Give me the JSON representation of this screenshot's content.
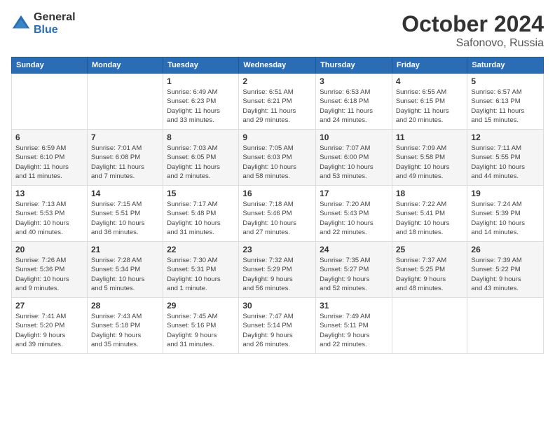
{
  "logo": {
    "general": "General",
    "blue": "Blue"
  },
  "title": "October 2024",
  "location": "Safonovo, Russia",
  "days_header": [
    "Sunday",
    "Monday",
    "Tuesday",
    "Wednesday",
    "Thursday",
    "Friday",
    "Saturday"
  ],
  "weeks": [
    [
      {
        "num": "",
        "info": ""
      },
      {
        "num": "",
        "info": ""
      },
      {
        "num": "1",
        "info": "Sunrise: 6:49 AM\nSunset: 6:23 PM\nDaylight: 11 hours\nand 33 minutes."
      },
      {
        "num": "2",
        "info": "Sunrise: 6:51 AM\nSunset: 6:21 PM\nDaylight: 11 hours\nand 29 minutes."
      },
      {
        "num": "3",
        "info": "Sunrise: 6:53 AM\nSunset: 6:18 PM\nDaylight: 11 hours\nand 24 minutes."
      },
      {
        "num": "4",
        "info": "Sunrise: 6:55 AM\nSunset: 6:15 PM\nDaylight: 11 hours\nand 20 minutes."
      },
      {
        "num": "5",
        "info": "Sunrise: 6:57 AM\nSunset: 6:13 PM\nDaylight: 11 hours\nand 15 minutes."
      }
    ],
    [
      {
        "num": "6",
        "info": "Sunrise: 6:59 AM\nSunset: 6:10 PM\nDaylight: 11 hours\nand 11 minutes."
      },
      {
        "num": "7",
        "info": "Sunrise: 7:01 AM\nSunset: 6:08 PM\nDaylight: 11 hours\nand 7 minutes."
      },
      {
        "num": "8",
        "info": "Sunrise: 7:03 AM\nSunset: 6:05 PM\nDaylight: 11 hours\nand 2 minutes."
      },
      {
        "num": "9",
        "info": "Sunrise: 7:05 AM\nSunset: 6:03 PM\nDaylight: 10 hours\nand 58 minutes."
      },
      {
        "num": "10",
        "info": "Sunrise: 7:07 AM\nSunset: 6:00 PM\nDaylight: 10 hours\nand 53 minutes."
      },
      {
        "num": "11",
        "info": "Sunrise: 7:09 AM\nSunset: 5:58 PM\nDaylight: 10 hours\nand 49 minutes."
      },
      {
        "num": "12",
        "info": "Sunrise: 7:11 AM\nSunset: 5:55 PM\nDaylight: 10 hours\nand 44 minutes."
      }
    ],
    [
      {
        "num": "13",
        "info": "Sunrise: 7:13 AM\nSunset: 5:53 PM\nDaylight: 10 hours\nand 40 minutes."
      },
      {
        "num": "14",
        "info": "Sunrise: 7:15 AM\nSunset: 5:51 PM\nDaylight: 10 hours\nand 36 minutes."
      },
      {
        "num": "15",
        "info": "Sunrise: 7:17 AM\nSunset: 5:48 PM\nDaylight: 10 hours\nand 31 minutes."
      },
      {
        "num": "16",
        "info": "Sunrise: 7:18 AM\nSunset: 5:46 PM\nDaylight: 10 hours\nand 27 minutes."
      },
      {
        "num": "17",
        "info": "Sunrise: 7:20 AM\nSunset: 5:43 PM\nDaylight: 10 hours\nand 22 minutes."
      },
      {
        "num": "18",
        "info": "Sunrise: 7:22 AM\nSunset: 5:41 PM\nDaylight: 10 hours\nand 18 minutes."
      },
      {
        "num": "19",
        "info": "Sunrise: 7:24 AM\nSunset: 5:39 PM\nDaylight: 10 hours\nand 14 minutes."
      }
    ],
    [
      {
        "num": "20",
        "info": "Sunrise: 7:26 AM\nSunset: 5:36 PM\nDaylight: 10 hours\nand 9 minutes."
      },
      {
        "num": "21",
        "info": "Sunrise: 7:28 AM\nSunset: 5:34 PM\nDaylight: 10 hours\nand 5 minutes."
      },
      {
        "num": "22",
        "info": "Sunrise: 7:30 AM\nSunset: 5:31 PM\nDaylight: 10 hours\nand 1 minute."
      },
      {
        "num": "23",
        "info": "Sunrise: 7:32 AM\nSunset: 5:29 PM\nDaylight: 9 hours\nand 56 minutes."
      },
      {
        "num": "24",
        "info": "Sunrise: 7:35 AM\nSunset: 5:27 PM\nDaylight: 9 hours\nand 52 minutes."
      },
      {
        "num": "25",
        "info": "Sunrise: 7:37 AM\nSunset: 5:25 PM\nDaylight: 9 hours\nand 48 minutes."
      },
      {
        "num": "26",
        "info": "Sunrise: 7:39 AM\nSunset: 5:22 PM\nDaylight: 9 hours\nand 43 minutes."
      }
    ],
    [
      {
        "num": "27",
        "info": "Sunrise: 7:41 AM\nSunset: 5:20 PM\nDaylight: 9 hours\nand 39 minutes."
      },
      {
        "num": "28",
        "info": "Sunrise: 7:43 AM\nSunset: 5:18 PM\nDaylight: 9 hours\nand 35 minutes."
      },
      {
        "num": "29",
        "info": "Sunrise: 7:45 AM\nSunset: 5:16 PM\nDaylight: 9 hours\nand 31 minutes."
      },
      {
        "num": "30",
        "info": "Sunrise: 7:47 AM\nSunset: 5:14 PM\nDaylight: 9 hours\nand 26 minutes."
      },
      {
        "num": "31",
        "info": "Sunrise: 7:49 AM\nSunset: 5:11 PM\nDaylight: 9 hours\nand 22 minutes."
      },
      {
        "num": "",
        "info": ""
      },
      {
        "num": "",
        "info": ""
      }
    ]
  ]
}
